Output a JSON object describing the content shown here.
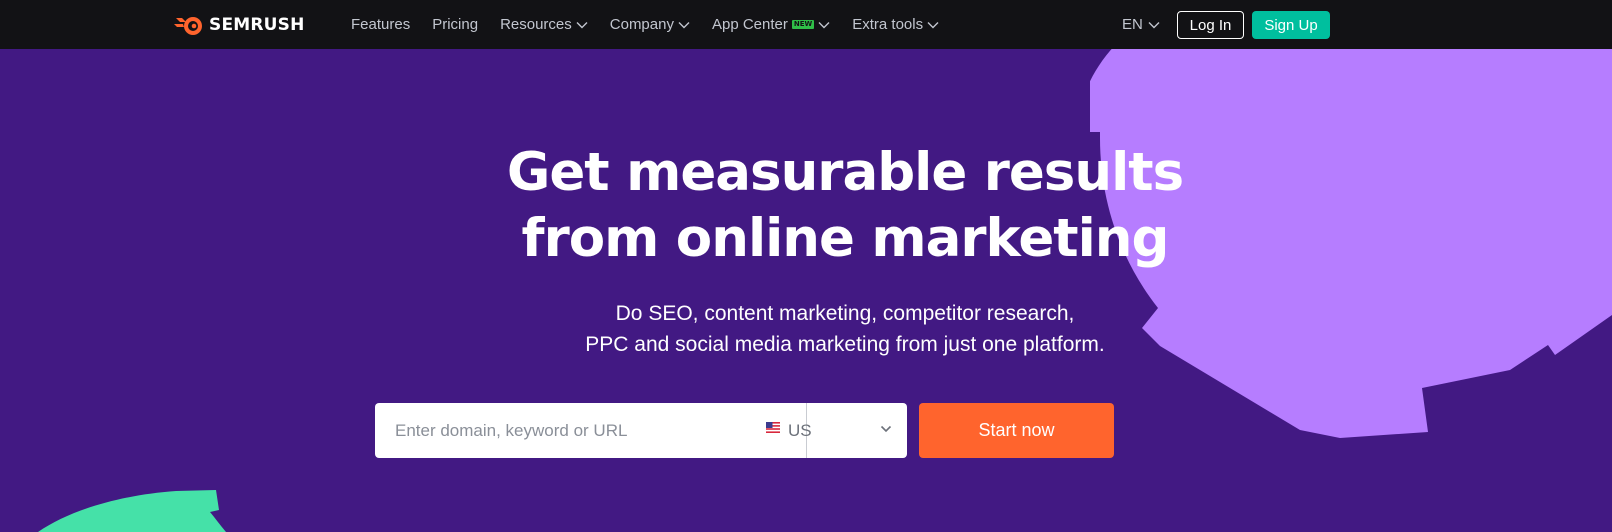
{
  "brand": {
    "name": "SEMRUSH",
    "logo_icon": "semrush-fire-icon",
    "color_orange": "#ff642d"
  },
  "nav": {
    "items": [
      {
        "label": "Features",
        "icon": ""
      },
      {
        "label": "Pricing",
        "icon": ""
      },
      {
        "label": "Resources",
        "icon": "chevron-down-icon"
      },
      {
        "label": "Company",
        "icon": "chevron-down-icon"
      },
      {
        "label": "App Center",
        "badge": "NEW",
        "icon": "chevron-down-icon"
      },
      {
        "label": "Extra tools",
        "icon": "chevron-down-icon"
      }
    ],
    "language": "EN",
    "login_label": "Log In",
    "signup_label": "Sign Up"
  },
  "hero": {
    "title_line1": "Get measurable results",
    "title_line2": "from online marketing",
    "subtitle_line1": "Do SEO, content marketing, competitor research,",
    "subtitle_line2": "PPC and social media marketing from just one platform."
  },
  "search": {
    "placeholder": "Enter domain, keyword or URL",
    "value": "",
    "database": "US",
    "flag_icon": "us-flag-icon",
    "cta_label": "Start now"
  },
  "colors": {
    "background": "#421983",
    "topbar": "#121215",
    "signup": "#00bf9e",
    "cta": "#ff642d",
    "deco_purple": "#b67dff",
    "deco_green": "#45e1a8"
  }
}
